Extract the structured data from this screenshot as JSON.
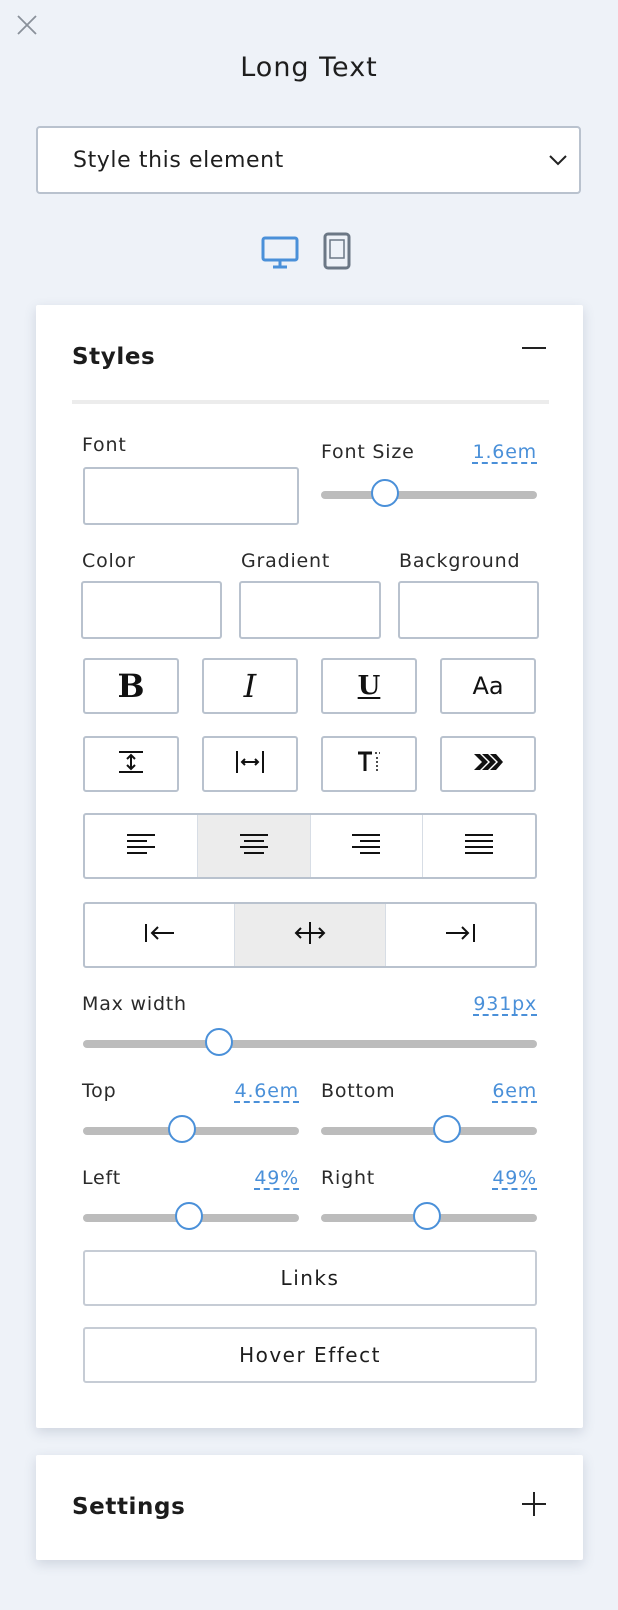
{
  "panel": {
    "title": "Long Text"
  },
  "style_select": {
    "selected": "Style this element"
  },
  "devices": {
    "desktop_icon": "desktop-icon",
    "tablet_icon": "tablet-icon",
    "active_color": "#4a90d9",
    "inactive_color": "#6b7785"
  },
  "styles": {
    "title": "Styles",
    "collapse_icon": "minus-icon",
    "font": {
      "label": "Font",
      "value": ""
    },
    "font_size": {
      "label": "Font Size",
      "value": "1.6em",
      "level": 0.3
    },
    "color": {
      "label": "Color",
      "value": ""
    },
    "gradient": {
      "label": "Gradient",
      "value": ""
    },
    "background": {
      "label": "Background",
      "value": ""
    },
    "text_format_buttons": [
      {
        "name": "bold",
        "glyph": "B"
      },
      {
        "name": "italic",
        "glyph": "I"
      },
      {
        "name": "underline",
        "glyph": "U"
      },
      {
        "name": "text-case",
        "glyph": "Aa"
      }
    ],
    "spacing_buttons": [
      "line-height-icon",
      "letter-spacing-icon",
      "text-transform-icon",
      "text-shadow-icon"
    ],
    "text_align": {
      "options": [
        "left",
        "center",
        "right",
        "justify"
      ],
      "selected": "center"
    },
    "block_align": {
      "options": [
        "left",
        "center",
        "right"
      ],
      "selected": "center"
    },
    "max_width": {
      "label": "Max width",
      "value": "931px",
      "level": 0.3
    },
    "top": {
      "label": "Top",
      "value": "4.6em",
      "level": 0.46
    },
    "bottom": {
      "label": "Bottom",
      "value": "6em",
      "level": 0.58
    },
    "left": {
      "label": "Left",
      "value": "49%",
      "level": 0.49
    },
    "right": {
      "label": "Right",
      "value": "49%",
      "level": 0.49
    },
    "links_button": "Links",
    "hover_button": "Hover Effect"
  },
  "settings": {
    "title": "Settings",
    "expand_icon": "plus-icon"
  },
  "colors": {
    "accent": "#4a90d9",
    "border": "#b9c2ce",
    "background": "#eef2f8"
  }
}
